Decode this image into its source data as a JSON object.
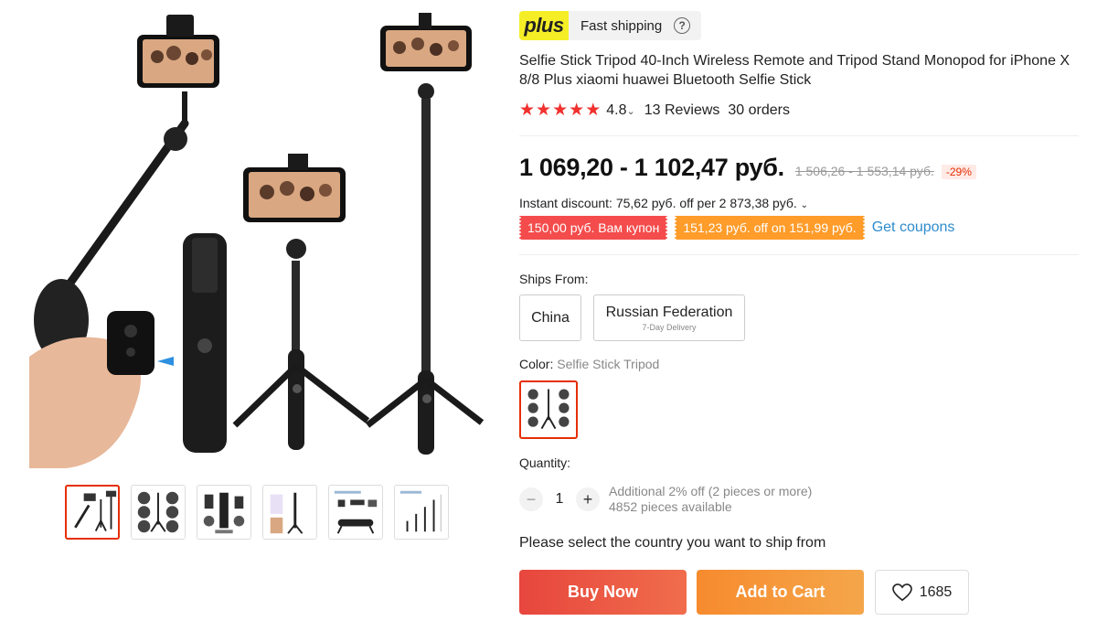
{
  "gallery": {
    "main_image_alt": "Selfie stick tripod product photo",
    "thumbnails": [
      {
        "name": "thumb-1",
        "active": true
      },
      {
        "name": "thumb-2",
        "active": false
      },
      {
        "name": "thumb-3",
        "active": false
      },
      {
        "name": "thumb-4",
        "active": false
      },
      {
        "name": "thumb-5",
        "active": false
      },
      {
        "name": "thumb-6",
        "active": false
      }
    ]
  },
  "plus": {
    "logo": "plus",
    "label": "Fast shipping",
    "help": "?"
  },
  "product": {
    "title": "Selfie Stick Tripod 40-Inch Wireless Remote and Tripod Stand Monopod for iPhone X 8/8 Plus xiaomi huawei Bluetooth Selfie Stick",
    "rating": "4.8",
    "reviews": "13 Reviews",
    "orders": "30 orders",
    "stars": 5
  },
  "price": {
    "current": "1 069,20 - 1 102,47 руб.",
    "old": "1 506,26 - 1 553,14 руб.",
    "discount": "-29%"
  },
  "instant_discount": "Instant discount: 75,62 руб. off per 2 873,38 руб.",
  "coupons": {
    "red": "150,00 руб. Вам купон",
    "orange": "151,23 руб. off on 151,99 руб.",
    "link": "Get coupons"
  },
  "ships_from": {
    "label": "Ships From:",
    "options": [
      {
        "name": "China",
        "sub": ""
      },
      {
        "name": "Russian Federation",
        "sub": "7-Day Delivery"
      }
    ]
  },
  "color": {
    "label": "Color:",
    "selected": "Selfie Stick Tripod"
  },
  "quantity": {
    "label": "Quantity:",
    "value": "1",
    "minus": "−",
    "plus": "+",
    "offer": "Additional 2% off (2 pieces or more)",
    "available": "4852 pieces available"
  },
  "ship_message": "Please select the country you want to ship from",
  "actions": {
    "buy_now": "Buy Now",
    "add_to_cart": "Add to Cart",
    "wishlist_count": "1685"
  },
  "colors": {
    "accent_red": "#e62e04",
    "star_red": "#f0312e",
    "link_blue": "#2e8ccc",
    "plus_yellow": "#f5ee27"
  }
}
